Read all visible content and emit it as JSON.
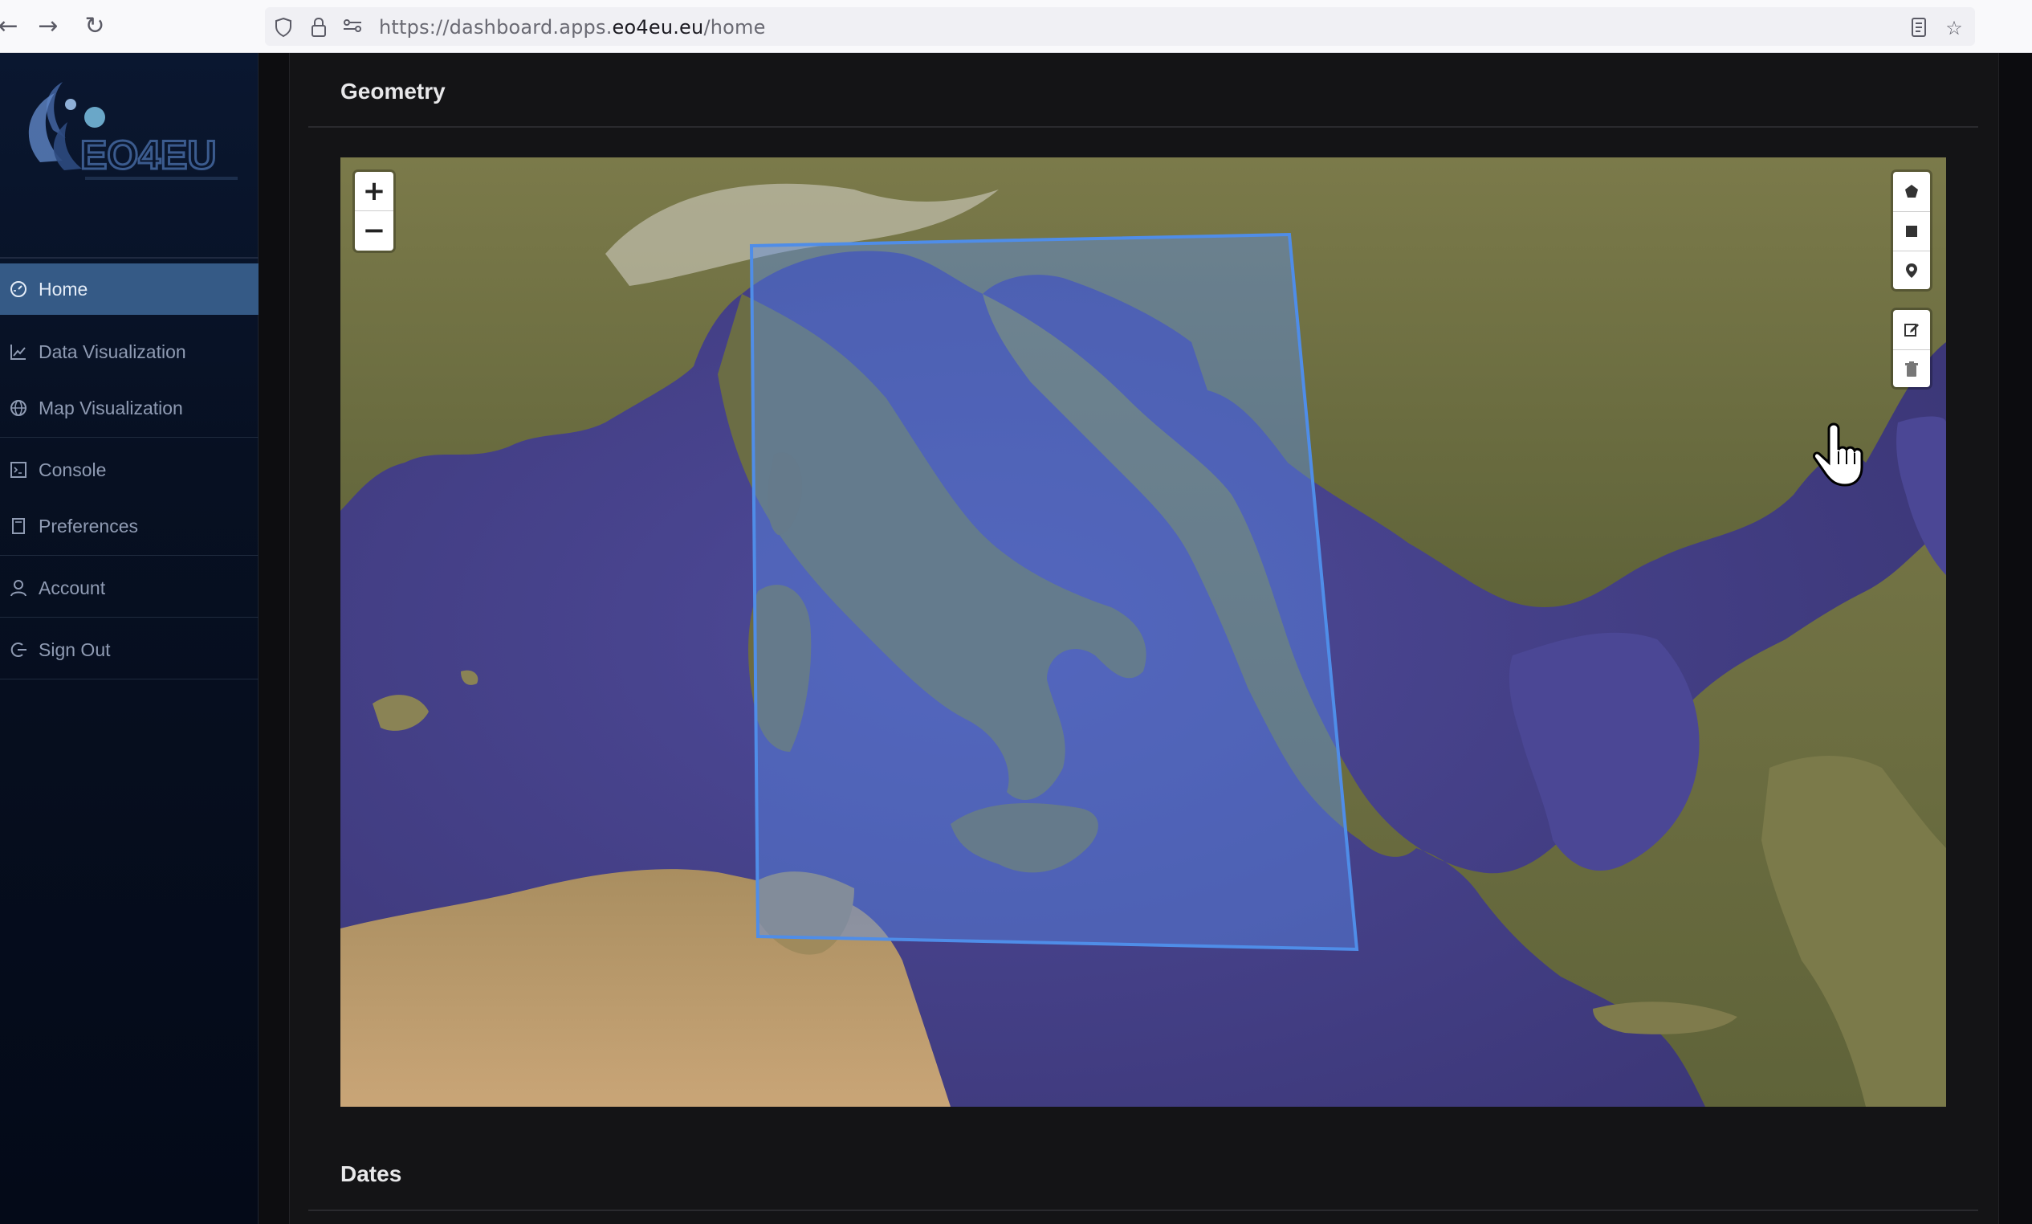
{
  "browser": {
    "url_prefix": "https://dashboard.apps.",
    "url_host": "eo4eu.eu",
    "url_path": "/home",
    "icons": [
      "back-icon",
      "forward-icon",
      "reload-icon",
      "shield-icon",
      "lock-icon",
      "permissions-icon",
      "reader-view-icon",
      "bookmark-star-icon"
    ]
  },
  "sidebar": {
    "logo_text": "EO4EU",
    "items": [
      {
        "label": "Home",
        "icon": "dashboard-icon",
        "active": true
      },
      {
        "label": "Data Visualization",
        "icon": "line-chart-icon",
        "active": false
      },
      {
        "label": "Map Visualization",
        "icon": "globe-icon",
        "active": false
      },
      {
        "label": "Console",
        "icon": "terminal-icon",
        "active": false
      },
      {
        "label": "Preferences",
        "icon": "document-icon",
        "active": false
      },
      {
        "label": "Account",
        "icon": "user-icon",
        "active": false
      },
      {
        "label": "Sign Out",
        "icon": "logout-icon",
        "active": false
      }
    ]
  },
  "main": {
    "geometry_title": "Geometry",
    "dates_title": "Dates"
  },
  "map": {
    "zoom_in": "+",
    "zoom_out": "−",
    "draw_tools": [
      "polygon-icon",
      "rectangle-icon",
      "marker-icon"
    ],
    "edit_tools": [
      "edit-icon",
      "trash-icon"
    ],
    "selection_color": "#4f8de8"
  },
  "colors": {
    "accent": "#355a86",
    "sea": "#47428a",
    "land": "#6f6d3e"
  }
}
